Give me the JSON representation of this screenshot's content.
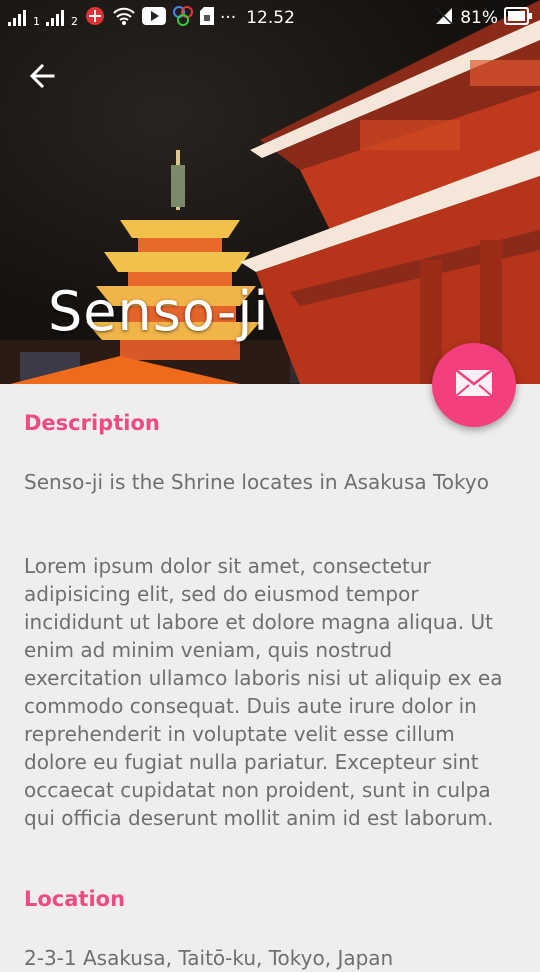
{
  "status_bar": {
    "sim1": "1",
    "sim2": "2",
    "dots": "···",
    "time": "12.52",
    "battery": "81%",
    "icons": [
      "signal-icon",
      "signal-icon",
      "cast-icon",
      "wifi-icon",
      "youtube-icon",
      "app-icon",
      "sd-card-icon",
      "notification-mute-icon",
      "battery-icon"
    ]
  },
  "header": {
    "back_icon": "arrow-back-icon",
    "title": "Senso-ji"
  },
  "fab": {
    "icon": "email-icon",
    "color": "#f23f7e"
  },
  "content": {
    "description_heading": "Description",
    "summary": "Senso-ji is the Shrine locates in Asakusa Tokyo",
    "body": "Lorem ipsum dolor sit amet, consectetur adipisicing elit, sed do eiusmod tempor incididunt ut labore et dolore magna aliqua. Ut enim ad minim veniam, quis nostrud exercitation ullamco laboris nisi ut aliquip ex ea commodo consequat. Duis aute irure dolor in reprehenderit in voluptate velit esse cillum dolore eu fugiat nulla pariatur. Excepteur sint occaecat cupidatat non proident, sunt in culpa qui officia deserunt mollit anim id est laborum.",
    "location_heading": "Location",
    "address": "2-3-1 Asakusa, Taitō-ku, Tokyo, Japan"
  },
  "colors": {
    "accent": "#ef4a84",
    "background": "#eeeeee",
    "text": "#6f6f6f"
  }
}
